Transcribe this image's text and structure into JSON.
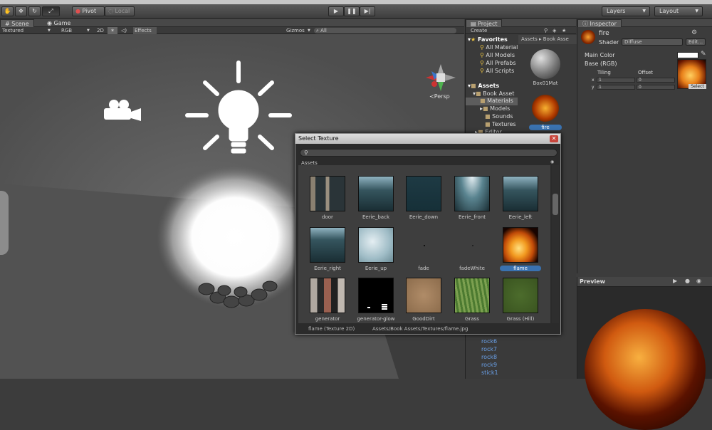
{
  "toolbar": {
    "pivot": "Pivot",
    "local": "Local",
    "layers": "Layers",
    "layout": "Layout"
  },
  "scene": {
    "tab_scene": "Scene",
    "tab_game": "Game",
    "mode": "Textured",
    "channel": "RGB",
    "view_2d": "2D",
    "effects": "Effects",
    "gizmos": "Gizmos",
    "search_placeholder": "All",
    "persp": "Persp"
  },
  "project": {
    "tab": "Project",
    "create": "Create",
    "favorites_label": "Favorites",
    "favorites": [
      "All Material",
      "All Models",
      "All Prefabs",
      "All Scripts"
    ],
    "assets_label": "Assets",
    "tree": [
      "Book Asset",
      "Materials",
      "Models",
      "Sounds",
      "Textures",
      "Editor"
    ],
    "breadcrumb_root": "Assets",
    "breadcrumb_child": "Book Asse",
    "asset_items": [
      {
        "name": "Box01Mat"
      },
      {
        "name": "fire"
      }
    ],
    "lower_list": [
      "rock6",
      "rock7",
      "rock8",
      "rock9",
      "stick1"
    ]
  },
  "inspector": {
    "tab": "Inspector",
    "name": "fire",
    "shader_label": "Shader",
    "shader_value": "Diffuse",
    "edit": "Edit...",
    "main_color": "Main Color",
    "base_rgb": "Base (RGB)",
    "tiling": "Tiling",
    "offset": "Offset",
    "x_label": "x",
    "y_label": "y",
    "tiling_x": "1",
    "tiling_y": "1",
    "offset_x": "0",
    "offset_y": "0",
    "select": "Select"
  },
  "preview": {
    "title": "Preview"
  },
  "dialog": {
    "title": "Select Texture",
    "section": "Assets",
    "textures": [
      {
        "name": "door"
      },
      {
        "name": "Eerie_back"
      },
      {
        "name": "Eerie_down"
      },
      {
        "name": "Eerie_front"
      },
      {
        "name": "Eerie_left"
      },
      {
        "name": "Eerie_right"
      },
      {
        "name": "Eerie_up"
      },
      {
        "name": "fade"
      },
      {
        "name": "fadeWhite"
      },
      {
        "name": "flame"
      },
      {
        "name": "generator"
      },
      {
        "name": "generator-glow"
      },
      {
        "name": "GoodDirt"
      },
      {
        "name": "Grass"
      },
      {
        "name": "Grass (Hill)"
      }
    ],
    "status_name": "flame (Texture 2D)",
    "status_path": "Assets/Book Assets/Textures/flame.jpg"
  },
  "colors": {
    "selection": "#3a72b0",
    "editor_bg": "#3c3c3c",
    "flame": "#e8801a"
  }
}
